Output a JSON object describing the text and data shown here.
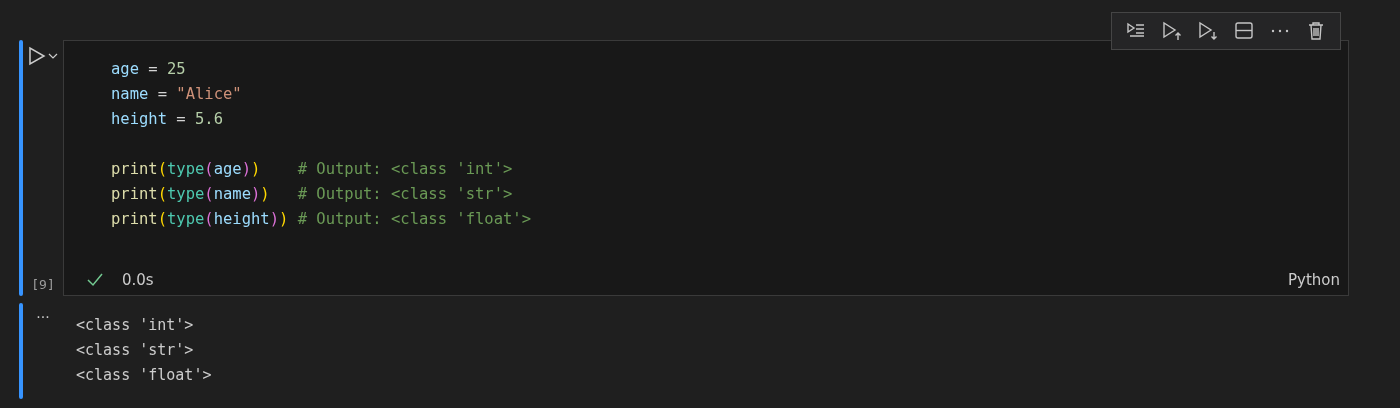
{
  "cell": {
    "execution_count": "[9]",
    "status": {
      "success": true,
      "duration": "0.0s"
    },
    "language": "Python",
    "toolbar": [
      {
        "kind": "run-by-line"
      },
      {
        "kind": "run-above"
      },
      {
        "kind": "run-below"
      },
      {
        "kind": "split"
      },
      {
        "kind": "more"
      },
      {
        "kind": "delete"
      }
    ],
    "lines": [
      {
        "kind": "code",
        "tokens": [
          {
            "kind": "var",
            "text": "age"
          },
          {
            "kind": "op",
            "text": " = "
          },
          {
            "kind": "num",
            "text": "25"
          }
        ]
      },
      {
        "kind": "code",
        "tokens": [
          {
            "kind": "var",
            "text": "name"
          },
          {
            "kind": "op",
            "text": " = "
          },
          {
            "kind": "str",
            "text": "\"Alice\""
          }
        ]
      },
      {
        "kind": "code",
        "tokens": [
          {
            "kind": "var",
            "text": "height"
          },
          {
            "kind": "op",
            "text": " = "
          },
          {
            "kind": "num",
            "text": "5.6"
          }
        ]
      },
      {
        "kind": "blank"
      },
      {
        "kind": "code",
        "tokens": [
          {
            "kind": "func",
            "text": "print"
          },
          {
            "kind": "paren1",
            "text": "("
          },
          {
            "kind": "builtin",
            "text": "type"
          },
          {
            "kind": "paren2",
            "text": "("
          },
          {
            "kind": "var",
            "text": "age"
          },
          {
            "kind": "paren2",
            "text": ")"
          },
          {
            "kind": "paren1",
            "text": ")    "
          },
          {
            "kind": "comment",
            "text": "# Output: <class 'int'>"
          }
        ]
      },
      {
        "kind": "code",
        "tokens": [
          {
            "kind": "func",
            "text": "print"
          },
          {
            "kind": "paren1",
            "text": "("
          },
          {
            "kind": "builtin",
            "text": "type"
          },
          {
            "kind": "paren2",
            "text": "("
          },
          {
            "kind": "var",
            "text": "name"
          },
          {
            "kind": "paren2",
            "text": ")"
          },
          {
            "kind": "paren1",
            "text": ")   "
          },
          {
            "kind": "comment",
            "text": "# Output: <class 'str'>"
          }
        ]
      },
      {
        "kind": "code",
        "tokens": [
          {
            "kind": "func",
            "text": "print"
          },
          {
            "kind": "paren1",
            "text": "("
          },
          {
            "kind": "builtin",
            "text": "type"
          },
          {
            "kind": "paren2",
            "text": "("
          },
          {
            "kind": "var",
            "text": "height"
          },
          {
            "kind": "paren2",
            "text": ")"
          },
          {
            "kind": "paren1",
            "text": ") "
          },
          {
            "kind": "comment",
            "text": "# Output: <class 'float'>"
          }
        ]
      }
    ]
  },
  "output": {
    "marker": "···",
    "lines": [
      "<class 'int'>",
      "<class 'str'>",
      "<class 'float'>"
    ]
  }
}
